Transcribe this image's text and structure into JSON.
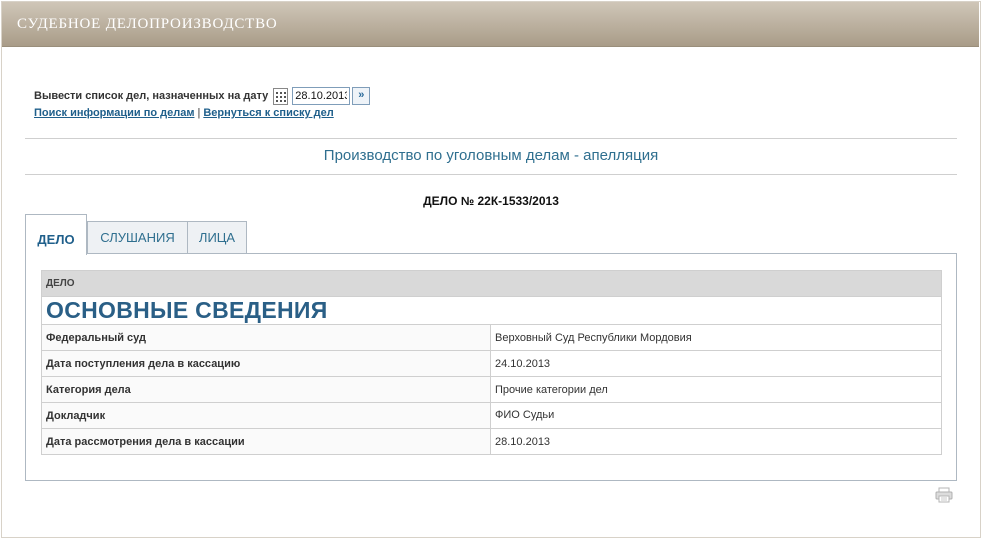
{
  "header": {
    "title": "СУДЕБНОЕ ДЕЛОПРОИЗВОДСТВО"
  },
  "date_filter": {
    "label": "Вывести список дел, назначенных на дату",
    "date_value": "28.10.2013",
    "go_icon": "double-chevron-right-icon",
    "calendar_icon": "calendar-icon"
  },
  "links": {
    "search": "Поиск информации по делам",
    "separator": "|",
    "back": "Вернуться к списку дел"
  },
  "section_title": "Производство по уголовным делам - апелляция",
  "case_number": "ДЕЛО № 22К-1533/2013",
  "tabs": [
    {
      "label": "ДЕЛО",
      "active": true
    },
    {
      "label": "СЛУШАНИЯ",
      "active": false
    },
    {
      "label": "ЛИЦА",
      "active": false
    }
  ],
  "table": {
    "header": "ДЕЛО",
    "heading": "ОСНОВНЫЕ СВЕДЕНИЯ",
    "rows": [
      {
        "label": "Федеральный суд",
        "value": "Верховный Суд Республики Мордовия"
      },
      {
        "label": "Дата поступления дела в кассацию",
        "value": "24.10.2013"
      },
      {
        "label": "Категория дела",
        "value": "Прочие категории дел"
      },
      {
        "label": "Докладчик",
        "value": "ФИО Судьи"
      },
      {
        "label": "Дата рассмотрения дела в кассации",
        "value": "28.10.2013"
      }
    ]
  },
  "print_icon": "printer-icon",
  "colors": {
    "header_bar": "#b3a794",
    "accent": "#2f6f8f",
    "link": "#1f5f8b"
  }
}
